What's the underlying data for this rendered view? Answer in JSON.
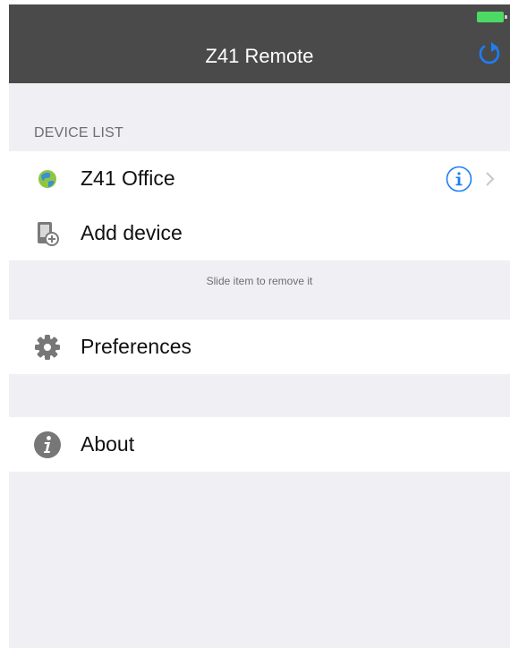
{
  "nav": {
    "title": "Z41 Remote",
    "battery_color": "#4cd964",
    "refresh_icon": "refresh-icon",
    "accent": "#1d7ef5"
  },
  "device_list": {
    "header": "DEVICE LIST",
    "items": [
      {
        "label": "Z41 Office",
        "icon": "globe-icon"
      },
      {
        "label": "Add device",
        "icon": "add-device-icon"
      }
    ],
    "footer": "Slide item to remove it"
  },
  "settings": {
    "preferences_label": "Preferences",
    "preferences_icon": "gear-icon"
  },
  "about": {
    "label": "About",
    "icon": "info-circle-icon"
  }
}
